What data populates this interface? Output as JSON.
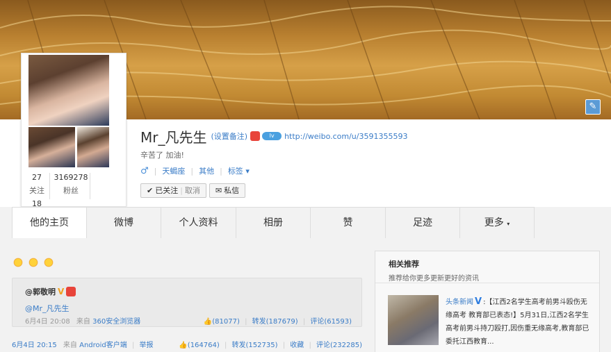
{
  "profile": {
    "name": "Mr_凡先生",
    "remark_label": "(设置备注)",
    "level_badge": "lv",
    "url": "http://weibo.com/u/3591355593",
    "bio": "辛苦了 加油!",
    "gender_symbol": "♂",
    "meta": [
      "天蝎座",
      "其他",
      "标签"
    ],
    "following_count": "27",
    "following_label": "关注",
    "fans_count": "3169278",
    "fans_label": "粉丝",
    "weibo_count": "18",
    "follow_status": "已关注",
    "cancel_label": "取消",
    "message_label": "私信"
  },
  "tabs": [
    "他的主页",
    "微博",
    "个人资料",
    "相册",
    "赞",
    "足迹",
    "更多"
  ],
  "feed": {
    "repost": {
      "author": "@郭敬明",
      "mention": "@Mr_凡先生",
      "date": "6月4日 20:08",
      "source_prefix": "来自",
      "source": "360安全浏览器",
      "likes": "(81077)",
      "forwards": "转发(187679)",
      "comments": "评论(61593)"
    },
    "post": {
      "date": "6月4日 20:15",
      "source_prefix": "来自",
      "source": "Android客户端",
      "report": "举报",
      "likes": "(164764)",
      "forwards": "转发(152735)",
      "collect": "收藏",
      "comments": "评论(232285)"
    }
  },
  "recommend": {
    "title": "相关推荐",
    "subtitle": "推荐给你更多更新更好的资讯",
    "news_source": "头条新闻",
    "news_text": ":【江西2名学生高考前男斗殴伤无缘高考 教育部已表态!】5月31日,江西2名学生高考前男斗持刀殴打,因伤重无缘高考,教育部已委托江西教育..."
  },
  "colors": {
    "link": "#3a7cc7",
    "banner": "#c28a33"
  }
}
